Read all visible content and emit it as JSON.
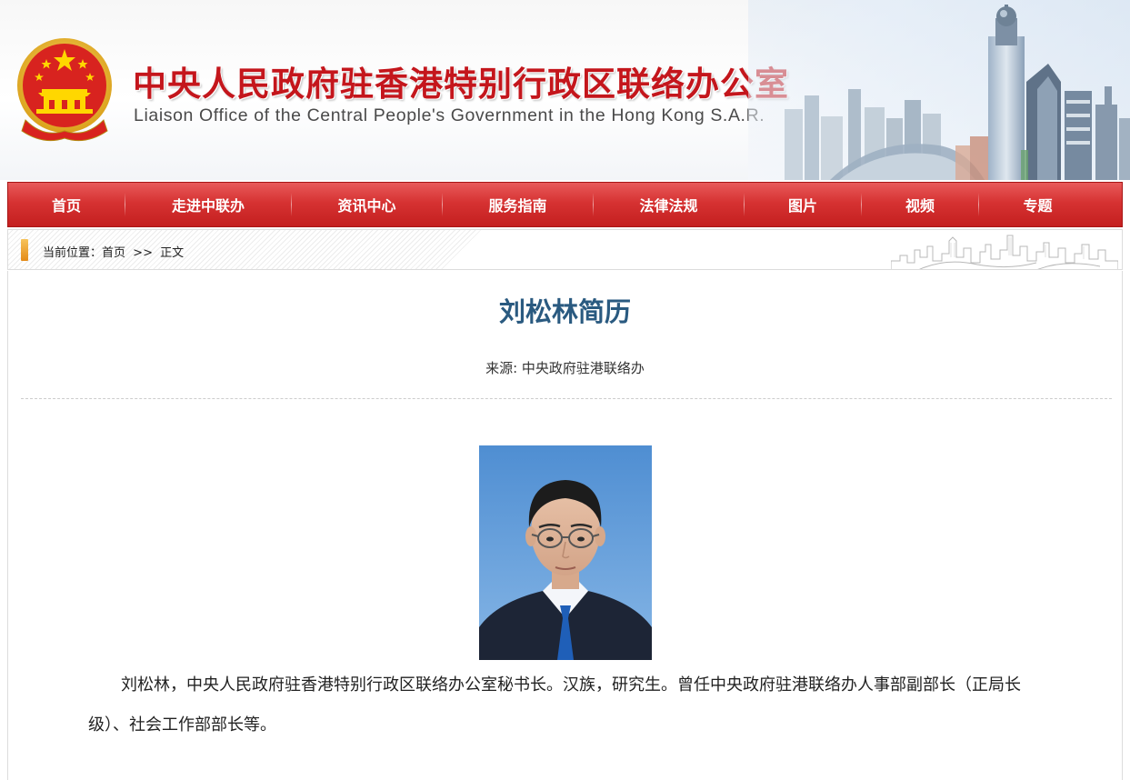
{
  "header": {
    "title_cn": "中央人民政府驻香港特别行政区联络办公室",
    "title_en": "Liaison Office of the Central People's Government in the Hong Kong S.A.R."
  },
  "nav": {
    "items": [
      {
        "label": "首页"
      },
      {
        "label": "走进中联办"
      },
      {
        "label": "资讯中心"
      },
      {
        "label": "服务指南"
      },
      {
        "label": "法律法规"
      },
      {
        "label": "图片"
      },
      {
        "label": "视频"
      },
      {
        "label": "专题"
      }
    ]
  },
  "breadcrumb": {
    "prefix": "当前位置：",
    "home": "首页",
    "separator": ">>",
    "current": "正文"
  },
  "article": {
    "title": "刘松林简历",
    "source": "来源: 中央政府驻港联络办",
    "body": "刘松林，中央人民政府驻香港特别行政区联络办公室秘书长。汉族，研究生。曾任中央政府驻港联络办人事部副部长（正局长级）、社会工作部部长等。"
  },
  "colors": {
    "brand_red": "#c4161c",
    "nav_red": "#d63232",
    "title_blue": "#2a5a80"
  },
  "icons": {
    "emblem": "national-emblem",
    "breadcrumb_marker": "bar-marker-icon"
  }
}
